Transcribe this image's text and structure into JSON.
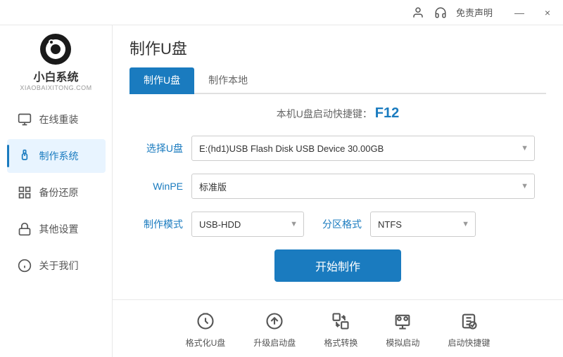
{
  "titlebar": {
    "free_declaration": "免责声明",
    "minimize_label": "—",
    "close_label": "×"
  },
  "sidebar": {
    "logo": {
      "cn": "小白系统",
      "en": "XIAOBAIXITONG.COM"
    },
    "items": [
      {
        "id": "online-reinstall",
        "label": "在线重装",
        "icon": "monitor"
      },
      {
        "id": "make-system",
        "label": "制作系统",
        "icon": "usb",
        "active": true
      },
      {
        "id": "backup-restore",
        "label": "备份还原",
        "icon": "grid"
      },
      {
        "id": "other-settings",
        "label": "其他设置",
        "icon": "lock"
      },
      {
        "id": "about-us",
        "label": "关于我们",
        "icon": "info"
      }
    ]
  },
  "content": {
    "page_title": "制作U盘",
    "tabs": [
      {
        "id": "make-usb",
        "label": "制作U盘",
        "active": true
      },
      {
        "id": "make-local",
        "label": "制作本地",
        "active": false
      }
    ],
    "shortcut": {
      "prefix": "本机U盘启动快捷键：",
      "key": "F12"
    },
    "form": {
      "select_usb_label": "选择U盘",
      "select_usb_value": "E:(hd1)USB Flash Disk USB Device 30.00GB",
      "winpe_label": "WinPE",
      "winpe_value": "标准版",
      "make_mode_label": "制作模式",
      "make_mode_value": "USB-HDD",
      "partition_label": "分区格式",
      "partition_value": "NTFS"
    },
    "start_button": "开始制作"
  },
  "bottom_tools": [
    {
      "id": "format-usb",
      "label": "格式化U盘",
      "icon": "format"
    },
    {
      "id": "upgrade-boot",
      "label": "升级启动盘",
      "icon": "upgrade"
    },
    {
      "id": "format-convert",
      "label": "格式转换",
      "icon": "convert"
    },
    {
      "id": "simulate-boot",
      "label": "模拟启动",
      "icon": "simulate"
    },
    {
      "id": "boot-shortcut",
      "label": "启动快捷键",
      "icon": "shortcut"
    }
  ]
}
